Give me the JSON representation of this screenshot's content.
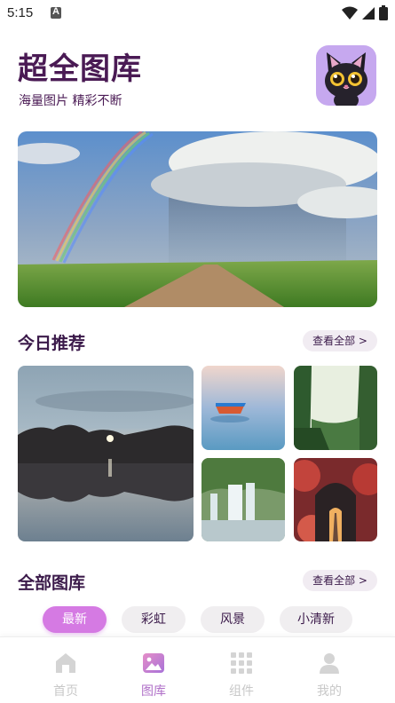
{
  "status_bar": {
    "time": "5:15"
  },
  "header": {
    "title": "超全图库",
    "subtitle": "海量图片 精彩不断"
  },
  "today": {
    "title_plain": "今日",
    "title_highlight": "推荐",
    "view_all": "查看全部 >"
  },
  "all": {
    "title_plain": "全部",
    "title_highlight": "图库",
    "view_all": "查看全部 >"
  },
  "categories": [
    "最新",
    "彩虹",
    "风景",
    "小清新"
  ],
  "active_category": "最新",
  "tabs": [
    {
      "label": "首页",
      "icon": "home-icon"
    },
    {
      "label": "图库",
      "icon": "gallery-icon"
    },
    {
      "label": "组件",
      "icon": "grid-icon"
    },
    {
      "label": "我的",
      "icon": "profile-icon"
    }
  ],
  "active_tab": "图库",
  "colors": {
    "brand": "#4a1a54",
    "accent": "#d57ae3",
    "highlight": "#ffd84d",
    "tab_active": "#b070c8",
    "tab_inactive": "#c8c8c8"
  }
}
